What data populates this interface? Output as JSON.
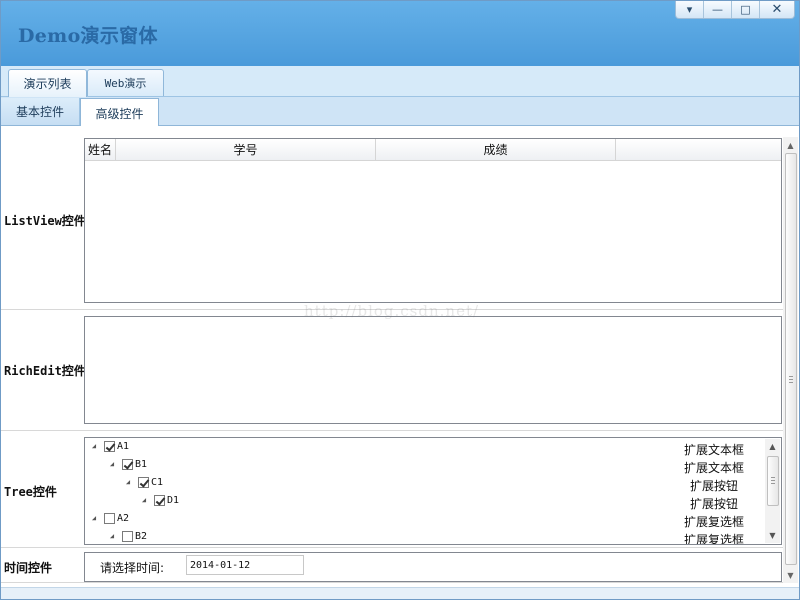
{
  "window": {
    "title": "Demo演示窗体",
    "buttons": {
      "menu": "▾",
      "minimize": "—",
      "maximize": "□",
      "close": "✕"
    }
  },
  "top_tabs": [
    {
      "label": "演示列表",
      "active": true
    },
    {
      "label": "Web演示",
      "active": false
    }
  ],
  "sub_tabs": [
    {
      "label": "基本控件",
      "active": false
    },
    {
      "label": "高级控件",
      "active": true
    }
  ],
  "rows": {
    "listview_label": "ListView控件",
    "richedit_label": "RichEdit控件",
    "tree_label": "Tree控件",
    "time_label": "时间控件"
  },
  "listview": {
    "columns": [
      "姓名",
      "学号",
      "成绩",
      ""
    ]
  },
  "tree": {
    "nodes": [
      {
        "label": "A1",
        "checked": true,
        "level": 0
      },
      {
        "label": "B1",
        "checked": true,
        "level": 1
      },
      {
        "label": "C1",
        "checked": true,
        "level": 2
      },
      {
        "label": "D1",
        "checked": true,
        "level": 3
      },
      {
        "label": "A2",
        "checked": false,
        "level": 0
      },
      {
        "label": "B2",
        "checked": false,
        "level": 1
      }
    ],
    "side_items": [
      "扩展文本框",
      "扩展文本框",
      "扩展按钮",
      "扩展按钮",
      "扩展复选框",
      "扩展复选框"
    ]
  },
  "time": {
    "prompt": "请选择时间:",
    "value": "2014-01-12"
  },
  "watermark": "http://blog.csdn.net/",
  "icons": {
    "expander": "triangle-expander-icon",
    "scroll_up": "up-arrow-icon",
    "scroll_down": "down-arrow-icon"
  }
}
